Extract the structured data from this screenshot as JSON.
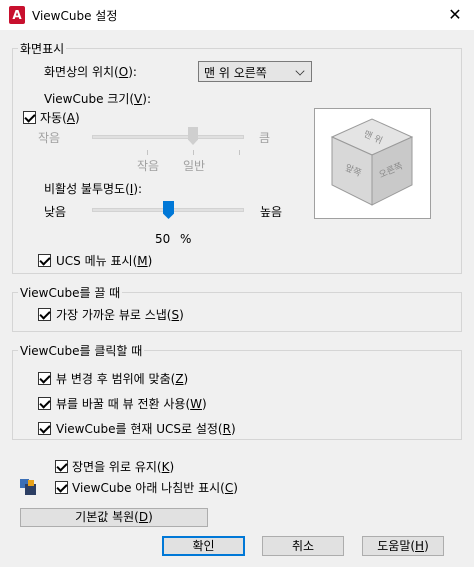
{
  "window": {
    "title": "ViewCube 설정",
    "app_icon": "autocad-icon",
    "close_glyph": "✕"
  },
  "display": {
    "group_title": "화면표시",
    "position_label_pre": "화면상의 위치(",
    "position_label_key": "O",
    "position_label_post": "):",
    "position_value": "맨 위 오른쪽",
    "size_label_pre": "ViewCube 크기(",
    "size_label_key": "V",
    "size_label_post": "):",
    "auto_label_pre": "자동(",
    "auto_label_key": "A",
    "auto_label_post": ")",
    "auto_checked": true,
    "size_min": "작음",
    "size_max": "큼",
    "size_tick_small": "작음",
    "size_tick_normal": "일반",
    "opacity_label_pre": "비활성 불투명도(",
    "opacity_label_key": "I",
    "opacity_label_post": "):",
    "opacity_min": "낮음",
    "opacity_max": "높음",
    "opacity_value": "50",
    "opacity_unit": "%",
    "ucs_menu_pre": "UCS 메뉴 표시(",
    "ucs_menu_key": "M",
    "ucs_menu_post": ")",
    "ucs_menu_checked": true
  },
  "preview": {
    "face_top": "맨 위",
    "face_front": "앞쪽",
    "face_right": "오른쪽"
  },
  "drag": {
    "group_title": "ViewCube를 끌 때",
    "snap_pre": "가장 가까운 뷰로 스냅(",
    "snap_key": "S",
    "snap_post": ")",
    "snap_checked": true
  },
  "click": {
    "group_title": "ViewCube를 클릭할 때",
    "zoom_pre": "뷰 변경 후 범위에 맞춤(",
    "zoom_key": "Z",
    "zoom_post": ")",
    "zoom_checked": true,
    "transition_pre": "뷰를 바꿀 때 뷰 전환 사용(",
    "transition_key": "W",
    "transition_post": ")",
    "transition_checked": true,
    "set_ucs_pre": "ViewCube를 현재 UCS로 설정(",
    "set_ucs_key": "R",
    "set_ucs_post": ")",
    "set_ucs_checked": true
  },
  "misc": {
    "keep_up_pre": "장면을 위로 유지(",
    "keep_up_key": "K",
    "keep_up_post": ")",
    "keep_up_checked": true,
    "compass_pre": "ViewCube 아래 나침반 표시(",
    "compass_key": "C",
    "compass_post": ")",
    "compass_checked": true
  },
  "buttons": {
    "defaults_pre": "기본값 복원(",
    "defaults_key": "D",
    "defaults_post": ")",
    "ok": "확인",
    "cancel": "취소",
    "help_pre": "도움말(",
    "help_key": "H",
    "help_post": ")"
  }
}
